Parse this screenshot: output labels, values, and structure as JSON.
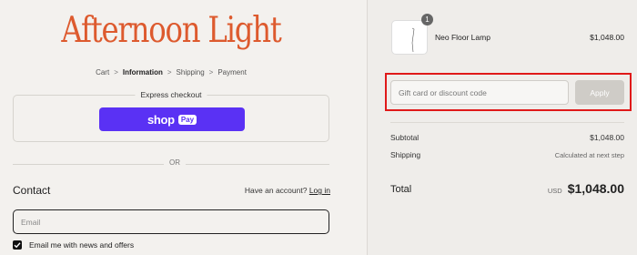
{
  "brand": "Afternoon Light",
  "breadcrumbs": [
    {
      "label": "Cart"
    },
    {
      "label": "Information"
    },
    {
      "label": "Shipping"
    },
    {
      "label": "Payment"
    }
  ],
  "breadcrumb_separator": ">",
  "express": {
    "title": "Express checkout",
    "shop_label": "shop",
    "pay_label": "Pay",
    "brand_color": "#5a31f4"
  },
  "divider_label": "OR",
  "contact": {
    "heading": "Contact",
    "account_prompt": "Have an account?",
    "login_label": "Log in",
    "email_placeholder": "Email",
    "email_value": "",
    "newsletter_label": "Email me with news and offers",
    "newsletter_checked": true
  },
  "cart": {
    "item": {
      "name": "Neo Floor Lamp",
      "price": "$1,048.00",
      "quantity": "1"
    },
    "discount_placeholder": "Gift card or discount code",
    "apply_label": "Apply",
    "subtotal_label": "Subtotal",
    "subtotal_value": "$1,048.00",
    "shipping_label": "Shipping",
    "shipping_value": "Calculated at next step",
    "total_label": "Total",
    "total_currency": "USD",
    "total_value": "$1,048.00"
  },
  "colors": {
    "brand_orange": "#dd5a2e",
    "highlight_red": "#e01919"
  }
}
